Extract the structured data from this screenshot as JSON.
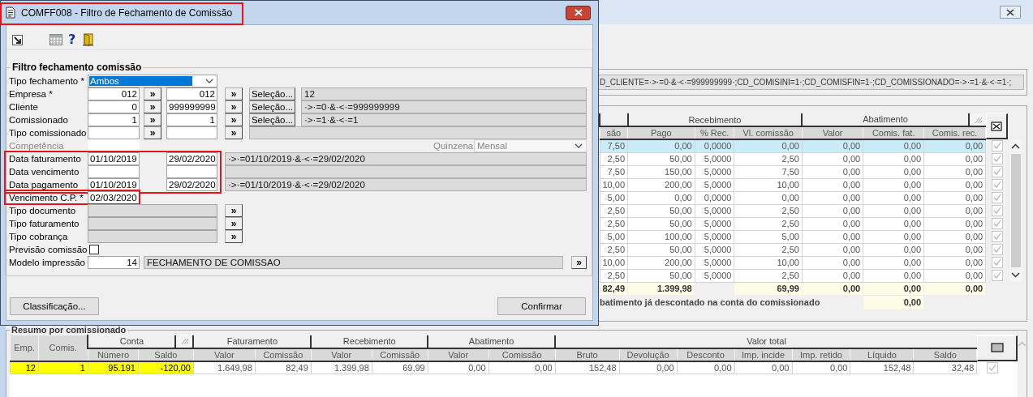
{
  "dialog": {
    "title": {
      "text": "COMFF008 - Filtro de Fechamento de Comissão",
      "highlighted": true
    },
    "toolbar": [
      {
        "kind": "import"
      },
      {
        "kind": "grid"
      },
      {
        "kind": "help",
        "glyph": "?"
      },
      {
        "kind": "exit"
      }
    ],
    "group_title": "Filtro fechamento comissão",
    "fields": [
      {
        "kind": "select",
        "label": "Tipo fechamento *",
        "value": "Ambos"
      },
      {
        "kind": "range",
        "label": "Empresa *",
        "from": "012",
        "from_button": "»",
        "to": "012",
        "to_button": "»",
        "select_button": "Seleção...",
        "summary": "12"
      },
      {
        "kind": "range",
        "label": "Cliente",
        "from": "0",
        "from_button": "»",
        "to": "999999999",
        "to_button": "»",
        "select_button": "Seleção...",
        "summary": "·>·=0·&·<·=999999999"
      },
      {
        "kind": "range",
        "label": "Comissionado",
        "from": "1",
        "from_button": "»",
        "to": "1",
        "to_button": "»",
        "select_button": "Seleção...",
        "summary": "·>·=1·&·<·=1"
      },
      {
        "kind": "range",
        "label": "Tipo comissionado",
        "from_button": "»",
        "to_button": "»"
      },
      {
        "kind": "period",
        "label": "Competência",
        "disabled": true,
        "period_label": "Quinzena",
        "period_value": "Mensal"
      },
      {
        "kind": "group",
        "highlighted": true,
        "fields": [
          {
            "kind": "date_range",
            "label": "Data faturamento",
            "from": "01/10/2019",
            "to": "29/02/2020",
            "summary": "·>·=01/10/2019·&·<·=29/02/2020"
          },
          {
            "kind": "date_range",
            "label": "Data vencimento"
          },
          {
            "kind": "date_range",
            "label": "Data pagamento",
            "from": "01/10/2019",
            "to": "29/02/2020",
            "summary": "·>·=01/10/2019·&·<·=29/02/2020"
          }
        ]
      },
      {
        "kind": "date",
        "label": "Vencimento C.P. *",
        "value": "02/03/2020",
        "highlighted": true
      },
      {
        "kind": "lookup",
        "label": "Tipo documento",
        "button": "»"
      },
      {
        "kind": "lookup",
        "label": "Tipo faturamento",
        "button": "»"
      },
      {
        "kind": "lookup",
        "label": "Tipo cobrança",
        "button": "»"
      },
      {
        "kind": "checkbox",
        "label": "Previsão comissão",
        "checked": false
      },
      {
        "kind": "model",
        "label": "Modelo impressão",
        "value": "14",
        "description": "FECHAMENTO DE COMISSAO",
        "button": "»"
      }
    ],
    "buttons": [
      {
        "label": "Classificação..."
      },
      {
        "label": "Confirmar"
      }
    ]
  },
  "main": {
    "filter_text": "D_CLIENTE=·>·=0·&·<·=999999999·;CD_COMISINI=1·;CD_COMISFIN=1·;CD_COMISSIONADO=·>·=1·&·<·=1·;",
    "detail": {
      "column_groups": [
        {
          "kind": "group",
          "columns": [
            "são"
          ]
        },
        {
          "kind": "group",
          "label": "Recebimento",
          "columns": [
            "Pago",
            "% Rec.",
            "Vl. comissão"
          ]
        },
        {
          "kind": "group_menu",
          "label": "Abatimento",
          "columns": [
            "Valor",
            "Comis. fat.",
            "Comis. rec."
          ]
        }
      ],
      "rows": [
        {
          "cells": [
            "7,50",
            "0,00",
            "0,0000",
            "0,00",
            "0,00",
            "0,00",
            "0,00"
          ],
          "selected": true,
          "checked": true
        },
        {
          "cells": [
            "2,50",
            "50,00",
            "5,0000",
            "2,50",
            "0,00",
            "0,00",
            "0,00"
          ],
          "selected": false,
          "checked": true
        },
        {
          "cells": [
            "7,50",
            "150,00",
            "5,0000",
            "7,50",
            "0,00",
            "0,00",
            "0,00"
          ],
          "selected": false,
          "checked": true
        },
        {
          "cells": [
            "10,00",
            "200,00",
            "5,0000",
            "10,00",
            "0,00",
            "0,00",
            "0,00"
          ],
          "selected": false,
          "checked": true
        },
        {
          "cells": [
            "5,00",
            "0,00",
            "0,0000",
            "0,00",
            "0,00",
            "0,00",
            "0,00"
          ],
          "selected": false,
          "checked": true
        },
        {
          "cells": [
            "2,50",
            "50,00",
            "5,0000",
            "2,50",
            "0,00",
            "0,00",
            "0,00"
          ],
          "selected": false,
          "checked": true
        },
        {
          "cells": [
            "2,50",
            "50,00",
            "5,0000",
            "2,50",
            "0,00",
            "0,00",
            "0,00"
          ],
          "selected": false,
          "checked": true
        },
        {
          "cells": [
            "5,00",
            "100,00",
            "5,0000",
            "5,00",
            "0,00",
            "0,00",
            "0,00"
          ],
          "selected": false,
          "checked": true
        },
        {
          "cells": [
            "2,50",
            "50,00",
            "5,0000",
            "2,50",
            "0,00",
            "0,00",
            "0,00"
          ],
          "selected": false,
          "checked": true
        },
        {
          "cells": [
            "10,00",
            "200,00",
            "5,0000",
            "10,00",
            "0,00",
            "0,00",
            "0,00"
          ],
          "selected": false,
          "checked": true
        },
        {
          "cells": [
            "2,50",
            "50,00",
            "5,0000",
            "2,50",
            "0,00",
            "0,00",
            "0,00"
          ],
          "selected": false,
          "checked": true
        }
      ],
      "totals": [
        {
          "kind": "value",
          "text": "82,49"
        },
        {
          "kind": "value",
          "text": "1.399,98"
        },
        {
          "kind": "empty"
        },
        {
          "kind": "value",
          "text": "69,99"
        },
        {
          "kind": "value",
          "text": "0,00"
        },
        {
          "kind": "value",
          "text": "0,00"
        },
        {
          "kind": "value",
          "text": "0,00"
        }
      ],
      "note": {
        "label": "batimento já descontado na conta do comissionado",
        "value": "0,00"
      }
    },
    "summary": {
      "title": "Resumo por comissionado",
      "column_groups": [
        {
          "kind": "single",
          "columns": [
            "Emp."
          ]
        },
        {
          "kind": "single",
          "columns": [
            "Comis."
          ]
        },
        {
          "kind": "group_menu",
          "label": "Conta",
          "columns": [
            "Número",
            "Saldo"
          ]
        },
        {
          "kind": "group",
          "label": "Faturamento",
          "columns": [
            "Valor",
            "Comissão"
          ]
        },
        {
          "kind": "group",
          "label": "Recebimento",
          "columns": [
            "Valor",
            "Comissão"
          ]
        },
        {
          "kind": "group",
          "label": "Abatimento",
          "columns": [
            "Valor",
            "Comissão"
          ]
        },
        {
          "kind": "group",
          "label": "Valor total",
          "columns": [
            "Bruto",
            "Devolução",
            "Desconto",
            "Imp. incide",
            "Imp. retido",
            "Líquido",
            "Saldo"
          ]
        }
      ],
      "rows": [
        {
          "checked": true,
          "cells": [
            {
              "text": "12",
              "highlighted": true
            },
            {
              "text": "1",
              "highlighted": true
            },
            {
              "text": "95.191",
              "highlighted": true
            },
            {
              "text": "-120,00",
              "highlighted": true
            },
            {
              "text": "1.649,98",
              "highlighted": false
            },
            {
              "text": "82,49",
              "highlighted": false
            },
            {
              "text": "1.399,98",
              "highlighted": false
            },
            {
              "text": "69,99",
              "highlighted": false
            },
            {
              "text": "0,00",
              "highlighted": false
            },
            {
              "text": "0,00",
              "highlighted": false
            },
            {
              "text": "152,48",
              "highlighted": false
            },
            {
              "text": "0,00",
              "highlighted": false
            },
            {
              "text": "0,00",
              "highlighted": false
            },
            {
              "text": "0,00",
              "highlighted": false
            },
            {
              "text": "0,00",
              "highlighted": false
            },
            {
              "text": "152,48",
              "highlighted": false
            },
            {
              "text": "32,48",
              "highlighted": false
            }
          ]
        }
      ]
    }
  }
}
